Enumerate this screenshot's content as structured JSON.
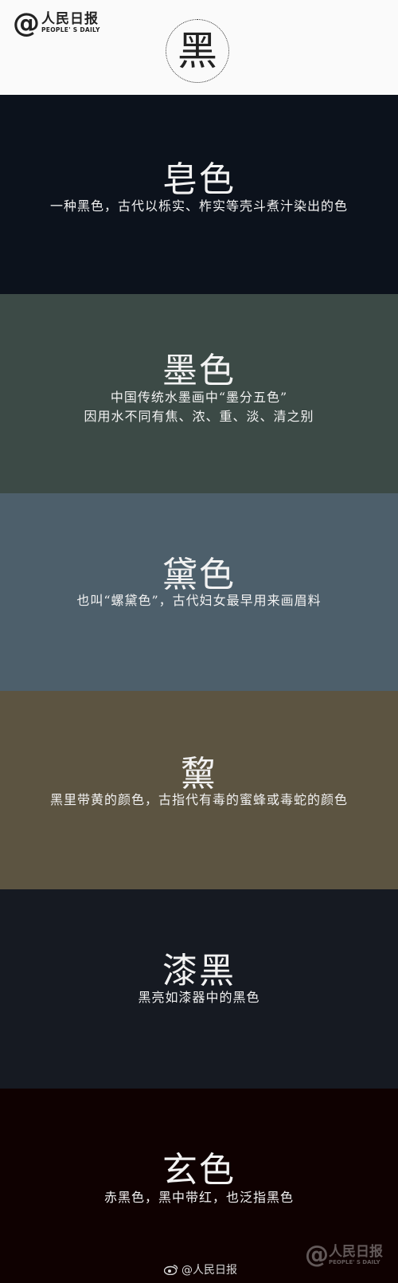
{
  "header": {
    "logo": {
      "at": "@",
      "cn": "人民日报",
      "en": "PEOPLE' S DAILY"
    },
    "title": "黑"
  },
  "colors": [
    {
      "name": "皂色",
      "desc_lines": [
        "一种黑色，古代以栎实、柞实等壳斗煮汁染出的色"
      ],
      "bg": "#0c121c"
    },
    {
      "name": "墨色",
      "desc_lines": [
        "中国传统水墨画中“墨分五色”",
        "因用水不同有焦、浓、重、淡、清之别"
      ],
      "bg": "#3c4a46"
    },
    {
      "name": "黛色",
      "desc_lines": [
        "也叫“螺黛色”，古代妇女最早用来画眉料"
      ],
      "bg": "#4d5f6b"
    },
    {
      "name": "黧",
      "desc_lines": [
        "黑里带黄的颜色，古指代有毒的蜜蜂或毒蛇的颜色"
      ],
      "bg": "#5c5441"
    },
    {
      "name": "漆黑",
      "desc_lines": [
        "黑亮如漆器中的黑色"
      ],
      "bg": "#161a22"
    },
    {
      "name": "玄色",
      "desc_lines": [
        "赤黑色，黑中带红，也泛指黑色"
      ],
      "bg": "#0f0101"
    }
  ],
  "footer": {
    "weibo_handle": "@人民日报",
    "weibo_icon": "weibo-icon",
    "watermark": {
      "at": "@",
      "cn": "人民日报",
      "en": "PEOPLE' S DAILY"
    }
  }
}
